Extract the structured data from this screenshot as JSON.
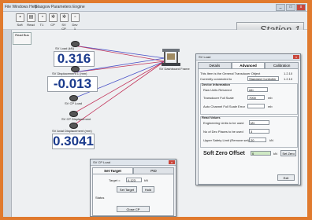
{
  "window": {
    "title": "Glasgow Parameters Engine",
    "menu": "File  Windows  Help"
  },
  "toolbar": {
    "buttons": [
      {
        "label": "Soft"
      },
      {
        "label": "Read"
      },
      {
        "label": "T1"
      },
      {
        "label": "CP"
      },
      {
        "label": "SV CP"
      },
      {
        "label": "Dev 1"
      }
    ]
  },
  "station_label": "Station 1",
  "small_panel": {
    "label": "Read Bus"
  },
  "readouts": [
    {
      "label": "SV Load (kN)",
      "value": "0.316"
    },
    {
      "label": "SV Displacement 1 (mm)",
      "value": "-0.013"
    },
    {
      "label": "SV CP Load",
      "value": ""
    },
    {
      "label": "SV CP Displacement",
      "value": ""
    },
    {
      "label": "SV Axial Displacement (mm)",
      "value": "0.3041"
    }
  ],
  "device_label": "SV Dashboard Frame",
  "sv_load_dialog": {
    "title": "SV Load",
    "tabs": [
      "Details",
      "Advanced",
      "Calibration"
    ],
    "active_tab": "Advanced",
    "info_line1": "This Item is the General Transducer Object",
    "info_line2": "Currently connected to",
    "connected_value": "Standard Controller",
    "side_values": [
      "1.2.10",
      "1.2.10"
    ],
    "device_info_title": "Device Information",
    "raw_units_label": "Raw Units Returned",
    "raw_units_value": "mb",
    "transducer_fs_label": "Transducer Full Scale",
    "transducer_fs_value": "7000",
    "transducer_fs_unit": "mb",
    "auto_channel_label": "Auto Channel Full Scale Error",
    "auto_channel_unit": "mb",
    "read_values_title": "Read Values",
    "eng_units_label": "Engineering Units to be used",
    "eng_units_value": "kN",
    "decimals_label": "No of Dec Places to be used",
    "decimals_value": "3",
    "upper_limit_label": "Upper Safety Limit (Remove set)",
    "upper_limit_value": "20",
    "upper_limit_unit": "kN",
    "soft_zero_label": "Soft Zero Offset",
    "soft_zero_value": "0",
    "soft_zero_unit": "kN",
    "set_zero_button": "Set Zero",
    "exit_button": "Exit"
  },
  "sv_cp_dialog": {
    "title": "SV CP Load",
    "tabs": [
      "Set Target",
      "PID"
    ],
    "active_tab": "Set Target",
    "target_label": "Target =",
    "target_value": "0.123",
    "target_unit": "kN",
    "set_target_button": "Set Target",
    "hold_button": "Hold",
    "status_label": "Status",
    "close_button": "Close CP"
  }
}
